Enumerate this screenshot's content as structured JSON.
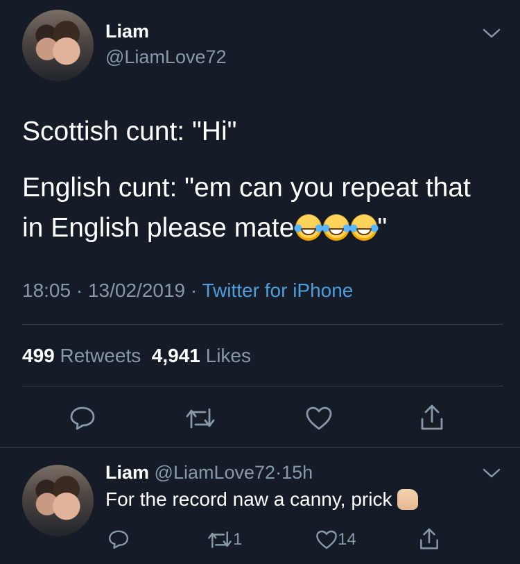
{
  "tweet": {
    "name": "Liam",
    "handle": "@LiamLove72",
    "line1": "Scottish cunt: \"Hi\"",
    "line2a": "English cunt: \"em can you repeat that",
    "line2b": "in English please mate",
    "line2c": "\"",
    "time": "18:05",
    "date": "13/02/2019",
    "source": "Twitter for iPhone",
    "retweets_count": "499",
    "retweets_label": "Retweets",
    "likes_count": "4,941",
    "likes_label": "Likes",
    "menu_icon": "chevron-down-icon"
  },
  "reply": {
    "name": "Liam",
    "handle": "@LiamLove72",
    "time": "15h",
    "text": "For the record naw a canny, prick",
    "retweet_count": "1",
    "like_count": "14"
  },
  "colors": {
    "background": "#151c27",
    "muted": "#8899a6",
    "link": "#4f9ddb",
    "divider": "#38444d"
  },
  "separators": {
    "dot": "·"
  }
}
